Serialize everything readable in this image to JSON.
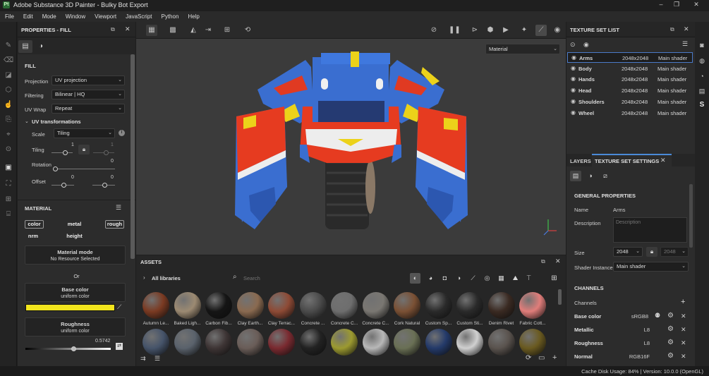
{
  "window": {
    "title": "Adobe Substance 3D Painter - Bulky Bot Export",
    "logo": "Pt"
  },
  "menu": [
    "File",
    "Edit",
    "Mode",
    "Window",
    "Viewport",
    "JavaScript",
    "Python",
    "Help"
  ],
  "properties": {
    "header": "PROPERTIES - FILL",
    "fill_title": "FILL",
    "projection": {
      "label": "Projection",
      "value": "UV projection"
    },
    "filtering": {
      "label": "Filtering",
      "value": "Bilinear | HQ"
    },
    "uvwrap": {
      "label": "UV Wrap",
      "value": "Repeat"
    },
    "uvt_title": "UV transformations",
    "scale": {
      "label": "Scale",
      "value": "Tiling"
    },
    "tiling": {
      "label": "Tiling",
      "v1": "1",
      "v2": "1"
    },
    "rotation": {
      "label": "Rotation",
      "value": "0"
    },
    "offset": {
      "label": "Offset",
      "v1": "0",
      "v2": "0"
    },
    "material_title": "MATERIAL",
    "channels": [
      "color",
      "metal",
      "rough",
      "nrm",
      "height"
    ],
    "material_mode": {
      "title": "Material mode",
      "sub": "No Resource Selected"
    },
    "or_text": "Or",
    "base_color": {
      "title": "Base color",
      "sub": "uniform color",
      "color": "#f2e51d"
    },
    "roughness": {
      "title": "Roughness",
      "sub": "uniform color",
      "value": "0.5742",
      "level": 0.5742
    }
  },
  "viewport": {
    "display_dropdown": "Material",
    "axis_x": "x",
    "axis_y": "y",
    "axis_z": "z"
  },
  "assets": {
    "header": "ASSETS",
    "breadcrumb": "All libraries",
    "search_placeholder": "Search",
    "items": [
      {
        "name": "Autumn Le...",
        "color": "#7a3a22"
      },
      {
        "name": "Baked Ligh...",
        "color": "#9c8a72"
      },
      {
        "name": "Carbon Fib...",
        "color": "#151515"
      },
      {
        "name": "Clay Earth...",
        "color": "#8a6a50"
      },
      {
        "name": "Clay Terrac...",
        "color": "#8e4a35"
      },
      {
        "name": "Concrete ...",
        "color": "#4a4a4a"
      },
      {
        "name": "Concrete C...",
        "color": "#6e6e6e"
      },
      {
        "name": "Concrete C...",
        "color": "#7a7772"
      },
      {
        "name": "Cork Natural",
        "color": "#7a5034"
      },
      {
        "name": "Custom Sp...",
        "color": "#2a2a2a"
      },
      {
        "name": "Custom Sti...",
        "color": "#2a2a2a"
      },
      {
        "name": "Denim Rivet",
        "color": "#3a2a22"
      },
      {
        "name": "Fabric Cott...",
        "color": "#e07d7a"
      }
    ],
    "row2_colors": [
      "#46546a",
      "#5a626c",
      "#3e3535",
      "#6a5d58",
      "#7a2a30",
      "#222222",
      "#9c9a30",
      "#b8b8b8",
      "#6a7055",
      "#243a6a",
      "#d0d0d0",
      "#5a534e",
      "#6a5a20"
    ]
  },
  "texture_set_list": {
    "header": "TEXTURE SET LIST",
    "rows": [
      {
        "name": "Arms",
        "res": "2048x2048",
        "shader": "Main shader"
      },
      {
        "name": "Body",
        "res": "2048x2048",
        "shader": "Main shader"
      },
      {
        "name": "Hands",
        "res": "2048x2048",
        "shader": "Main shader"
      },
      {
        "name": "Head",
        "res": "2048x2048",
        "shader": "Main shader"
      },
      {
        "name": "Shoulders",
        "res": "2048x2048",
        "shader": "Main shader"
      },
      {
        "name": "Wheel",
        "res": "2048x2048",
        "shader": "Main shader"
      }
    ]
  },
  "settings": {
    "tab_layers": "LAYERS",
    "tab_tss": "TEXTURE SET SETTINGS",
    "general": "GENERAL PROPERTIES",
    "name_label": "Name",
    "name_value": "Arms",
    "desc_label": "Description",
    "desc_placeholder": "Description",
    "size_label": "Size",
    "size_value": "2048",
    "size_locked": "2048",
    "shader_label": "Shader Instance",
    "shader_value": "Main shader",
    "channels_title": "CHANNELS",
    "channels_label": "Channels",
    "channels": [
      {
        "name": "Base color",
        "format": "sRGB8"
      },
      {
        "name": "Metallic",
        "format": "L8"
      },
      {
        "name": "Roughness",
        "format": "L8"
      },
      {
        "name": "Normal",
        "format": "RGB16F"
      }
    ]
  },
  "status": {
    "text": "Cache Disk Usage:  84% | Version: 10.0.0 (OpenGL)"
  }
}
